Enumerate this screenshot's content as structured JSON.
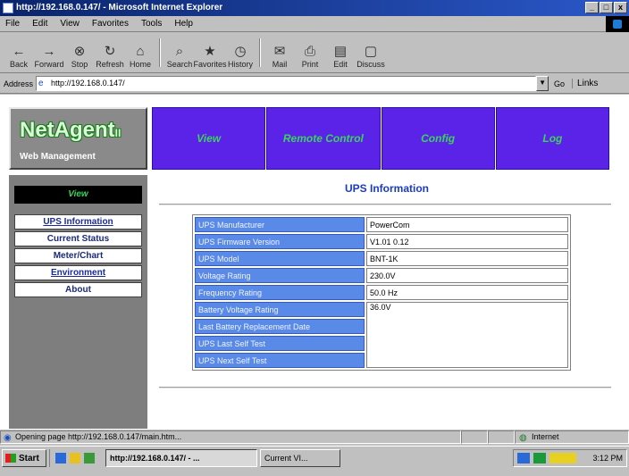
{
  "window": {
    "title": "http://192.168.0.147/ - Microsoft Internet Explorer",
    "buttons": [
      "_",
      "□",
      "x"
    ]
  },
  "menu": [
    "File",
    "Edit",
    "View",
    "Favorites",
    "Tools",
    "Help"
  ],
  "toolbar": [
    {
      "glyph": "←",
      "label": "Back",
      "icon": "back-icon"
    },
    {
      "glyph": "→",
      "label": "Forward",
      "icon": "forward-icon"
    },
    {
      "glyph": "⊗",
      "label": "Stop",
      "icon": "stop-icon"
    },
    {
      "glyph": "↻",
      "label": "Refresh",
      "icon": "refresh-icon"
    },
    {
      "glyph": "⌂",
      "label": "Home",
      "icon": "home-icon"
    },
    {
      "glyph": "⌕",
      "label": "Search",
      "icon": "search-icon"
    },
    {
      "glyph": "★",
      "label": "Favorites",
      "icon": "favorites-icon"
    },
    {
      "glyph": "◷",
      "label": "History",
      "icon": "history-icon"
    },
    {
      "glyph": "✉",
      "label": "Mail",
      "icon": "mail-icon"
    },
    {
      "glyph": "⎙",
      "label": "Print",
      "icon": "print-icon"
    },
    {
      "glyph": "▤",
      "label": "Edit",
      "icon": "edit-icon"
    },
    {
      "glyph": "▢",
      "label": "Discuss",
      "icon": "discuss-icon"
    }
  ],
  "address": {
    "label": "Address",
    "url": "http://192.168.0.147/",
    "go": "Go",
    "links": "Links"
  },
  "logo": {
    "main": "NetAgent",
    "suffix": "II",
    "sub": "Web Management"
  },
  "nav": {
    "tabs": [
      "View",
      "Remote Control",
      "Config",
      "Log"
    ]
  },
  "sidebar": {
    "heading": "View",
    "items": [
      "UPS Information",
      "Current Status",
      "Meter/Chart",
      "Environment",
      "About"
    ]
  },
  "main": {
    "title": "UPS Information",
    "rows": [
      {
        "label": "UPS Manufacturer",
        "value": "PowerCom"
      },
      {
        "label": "UPS Firmware Version",
        "value": "V1.01 0.12"
      },
      {
        "label": "UPS Model",
        "value": "BNT-1K"
      },
      {
        "label": "Voltage Rating",
        "value": "230.0V"
      },
      {
        "label": "Frequency Rating",
        "value": "50.0 Hz"
      },
      {
        "label": "Battery Voltage Rating",
        "value": "36.0V"
      },
      {
        "label": "Last Battery Replacement Date",
        "value": ""
      },
      {
        "label": "UPS Last Self Test",
        "value": ""
      },
      {
        "label": "UPS Next Self Test",
        "value": ""
      }
    ]
  },
  "status": {
    "text": "Opening page http://192.168.0.147/main.htm...",
    "zone": "Internet"
  },
  "taskbar": {
    "start": "Start",
    "tasks": [
      "http://192.168.0.147/ - ...",
      "Current VI..."
    ],
    "clock": "3:12 PM"
  }
}
